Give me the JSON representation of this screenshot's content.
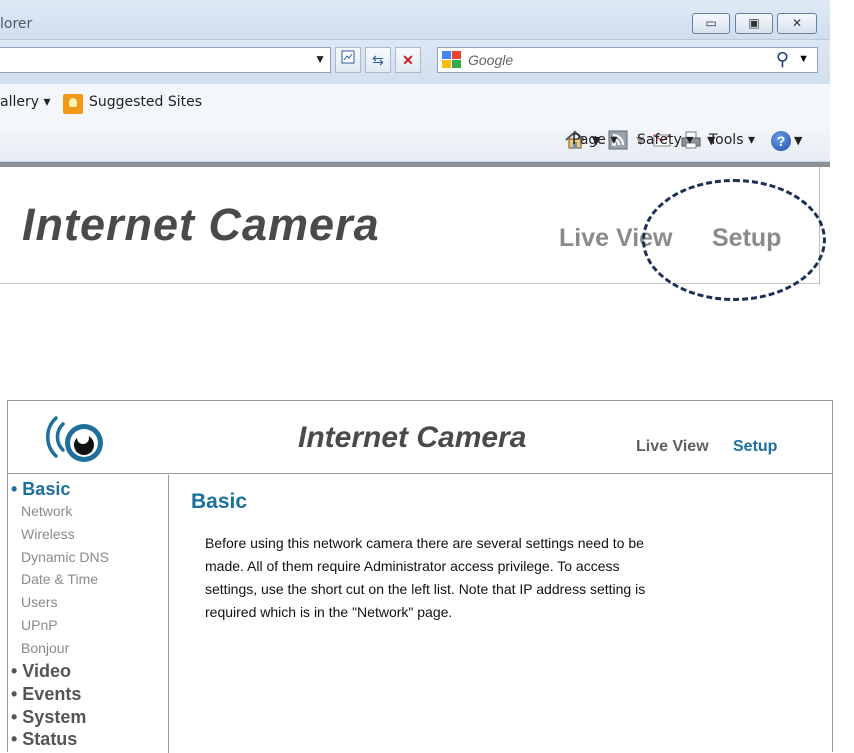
{
  "browser": {
    "title_partial": "lorer",
    "search_placeholder": "Google",
    "favorites": {
      "gallery": "allery ▾",
      "suggested": "Suggested Sites"
    },
    "commands": {
      "page": "Page ▾",
      "safety": "Safety ▾",
      "tools": "Tools ▾"
    },
    "window_buttons": {
      "minimize": "▭",
      "maximize": "▣",
      "close": "✕"
    }
  },
  "camera_header": {
    "title": "Internet Camera",
    "live_view": "Live View",
    "setup": "Setup"
  },
  "panel": {
    "title": "Internet Camera",
    "live_view": "Live View",
    "setup": "Setup",
    "sidebar": {
      "basic": "• Basic",
      "sub_items": [
        "Network",
        "Wireless",
        "Dynamic DNS",
        "Date & Time",
        "Users",
        "UPnP",
        "Bonjour"
      ],
      "video": "• Video",
      "events": "• Events",
      "system": "• System",
      "status": "• Status"
    },
    "content": {
      "heading": "Basic",
      "line1": "Before using this network camera there are several settings need to be",
      "line2": "made. All of them require Administrator access privilege. To access",
      "line3": "settings, use the short cut on the left list. Note that IP address setting is",
      "line4": "required which is in the \"Network\" page."
    }
  },
  "colors": {
    "accent": "#1d6f9c",
    "annotation": "#1c2f57"
  }
}
